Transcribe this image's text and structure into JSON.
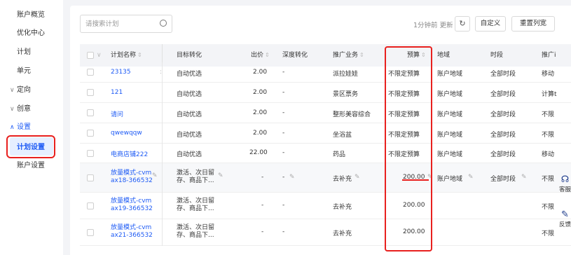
{
  "sidebar": {
    "items": [
      {
        "label": "账户概览",
        "type": "link"
      },
      {
        "label": "优化中心",
        "type": "link"
      },
      {
        "label": "计划",
        "type": "link"
      },
      {
        "label": "单元",
        "type": "link"
      },
      {
        "label": "定向",
        "type": "group",
        "caret": "∨"
      },
      {
        "label": "创意",
        "type": "group",
        "caret": "∨"
      },
      {
        "label": "设置",
        "type": "group",
        "caret": "∧"
      },
      {
        "label": "计划设置",
        "type": "active"
      },
      {
        "label": "账户设置",
        "type": "link"
      }
    ]
  },
  "toolbar": {
    "search_placeholder": "请搜索计划",
    "update_text": "1分钟前 更新",
    "refresh_icon": "↻",
    "customize_label": "自定义",
    "reset_label": "重置列宽"
  },
  "table": {
    "headers": {
      "name": "计划名称",
      "target": "目标转化",
      "bid": "出价",
      "deep": "深度转化",
      "business": "推广业务",
      "budget": "预算",
      "region": "地域",
      "period": "时段",
      "cut": "推广i"
    },
    "sort_glyph": "⇕",
    "rows": [
      {
        "name": "23135",
        "name2": "",
        "target": "自动优选",
        "target2": "",
        "bid": "2.00",
        "deep": "-",
        "business": "派拉娃娃",
        "budget": "不限定预算",
        "region": "账户地域",
        "period": "全部时段",
        "cut": "移动"
      },
      {
        "name": "121",
        "name2": "",
        "target": "自动优选",
        "target2": "",
        "bid": "2.00",
        "deep": "-",
        "business": "景区票务",
        "budget": "不限定预算",
        "region": "账户地域",
        "period": "全部时段",
        "cut": "计算t"
      },
      {
        "name": "请问",
        "name2": "",
        "target": "自动优选",
        "target2": "",
        "bid": "2.00",
        "deep": "-",
        "business": "整形美容综合",
        "budget": "不限定预算",
        "region": "账户地域",
        "period": "全部时段",
        "cut": "不限"
      },
      {
        "name": "qwewqqw",
        "name2": "",
        "target": "自动优选",
        "target2": "",
        "bid": "2.00",
        "deep": "-",
        "business": "坐浴盆",
        "budget": "不限定预算",
        "region": "账户地域",
        "period": "全部时段",
        "cut": "不限"
      },
      {
        "name": "电商店铺222",
        "name2": "",
        "target": "自动优选",
        "target2": "",
        "bid": "22.00",
        "deep": "-",
        "business": "药品",
        "budget": "不限定预算",
        "region": "账户地域",
        "period": "全部时段",
        "cut": "移动"
      },
      {
        "name": "放量模式-cvm",
        "name2": "ax18-366532",
        "target": "激活、次日留",
        "target2": "存、商品下...",
        "bid": "-",
        "deep": "-",
        "business": "去补充",
        "budget": "200.00",
        "region": "账户地域",
        "period": "全部时段",
        "cut": "不限"
      },
      {
        "name": "放量模式-cvm",
        "name2": "ax19-366532",
        "target": "激活、次日留",
        "target2": "存、商品下...",
        "bid": "-",
        "deep": "-",
        "business": "去补充",
        "budget": "200.00",
        "region": "",
        "period": "",
        "cut": "不限"
      },
      {
        "name": "放量模式-cvm",
        "name2": "ax21-366532",
        "target": "激活、次日留",
        "target2": "存、商品下...",
        "bid": "-",
        "deep": "-",
        "business": "去补充",
        "budget": "200.00",
        "region": "",
        "period": "",
        "cut": "不限"
      }
    ]
  },
  "floating": {
    "service_label": "客服",
    "feedback_label": "反馈"
  }
}
